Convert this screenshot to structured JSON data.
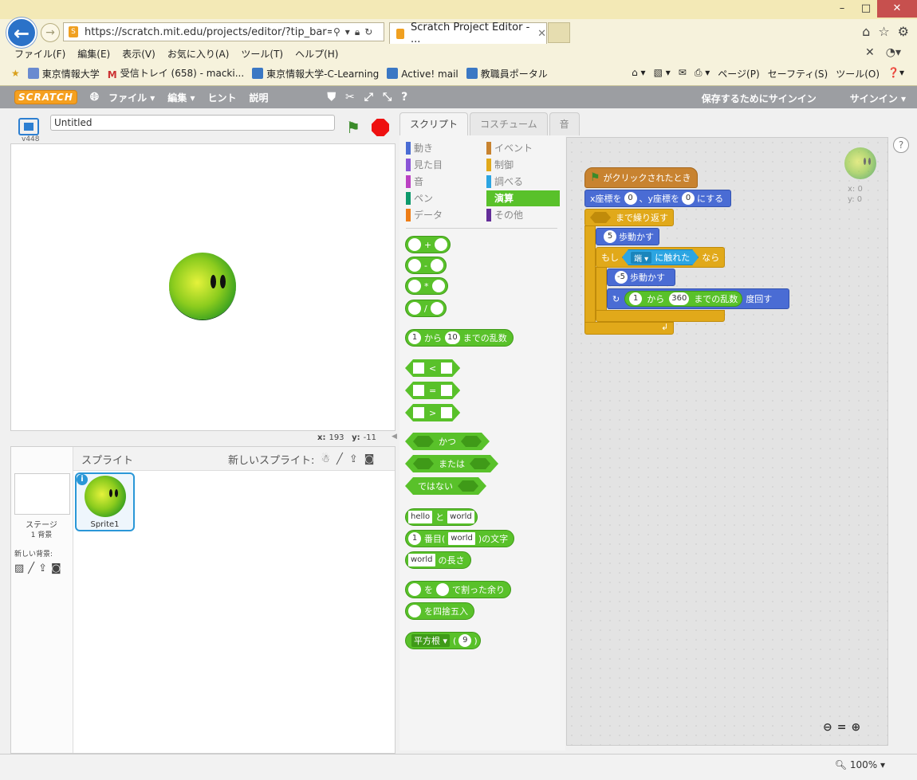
{
  "browser": {
    "url": "https://scratch.mit.edu/projects/editor/?tip_bar=get",
    "tab_title": "Scratch Project Editor - ...",
    "menus": [
      "ファイル(F)",
      "編集(E)",
      "表示(V)",
      "お気に入り(A)",
      "ツール(T)",
      "ヘルプ(H)"
    ],
    "favorites": [
      "東京情報大学",
      "受信トレイ (658) - macki...",
      "東京情報大学-C-Learning",
      "Active! mail",
      "教職員ポータル"
    ],
    "fav_right": [
      "ページ(P)",
      "セーフティ(S)",
      "ツール(O)"
    ],
    "zoom": "100%"
  },
  "scratch": {
    "logo": "SCRATCH",
    "menu": [
      "ファイル ▾",
      "編集 ▾",
      "ヒント",
      "説明"
    ],
    "signin_save": "保存するためにサインイン",
    "signin": "サインイン ▾"
  },
  "stage": {
    "version": "v448",
    "project_title": "Untitled",
    "x_label": "x:",
    "x_value": "193",
    "y_label": "y:",
    "y_value": "-11"
  },
  "sprites": {
    "title": "スプライト",
    "new_sprite": "新しいスプライト:",
    "stage_label": "ステージ",
    "stage_bg_count": "1 背景",
    "new_backdrop": "新しい背景:",
    "sprite1_name": "Sprite1"
  },
  "tabs": [
    "スクリプト",
    "コスチューム",
    "音"
  ],
  "categories": [
    {
      "label": "動き",
      "color": "#4a6cd4"
    },
    {
      "label": "イベント",
      "color": "#c88330"
    },
    {
      "label": "見た目",
      "color": "#8a55d7"
    },
    {
      "label": "制御",
      "color": "#e1a91a"
    },
    {
      "label": "音",
      "color": "#bb42c3"
    },
    {
      "label": "調べる",
      "color": "#2ca5e2"
    },
    {
      "label": "ペン",
      "color": "#0e9a6c"
    },
    {
      "label": "演算",
      "color": "#59c12a"
    },
    {
      "label": "データ",
      "color": "#ee7d16"
    },
    {
      "label": "その他",
      "color": "#632d99"
    }
  ],
  "palette": {
    "plus": "+",
    "minus": "-",
    "times": "*",
    "divide": "/",
    "random_from": "1",
    "random_mid": "から",
    "random_to": "10",
    "random_end": "までの乱数",
    "lt": "<",
    "eq": "=",
    "gt": ">",
    "and": "かつ",
    "or": "または",
    "not": "ではない",
    "join_a": "hello",
    "join_mid": "と",
    "join_b": "world",
    "letter_n": "1",
    "letter_mid": "番目(",
    "letter_s": "world",
    "letter_end": ")の文字",
    "length_s": "world",
    "length_end": "の長さ",
    "mod_a": "を",
    "mod_end": "で割った余り",
    "round": "を四捨五入",
    "sqrt_fn": "平方根 ▾",
    "sqrt_open": "(",
    "sqrt_val": "9",
    "sqrt_close": ")"
  },
  "script": {
    "when_flag": "がクリックされたとき",
    "goto_x_label": "x座標を",
    "goto_x": "0",
    "goto_y_label": "、y座標を",
    "goto_y": "0",
    "goto_end": "にする",
    "repeat_until": "まで繰り返す",
    "move_n": "5",
    "move_label": "歩動かす",
    "if_label": "もし",
    "touching_dd": "端 ▾",
    "touching_label": "に触れた",
    "then_label": "なら",
    "move_back_n": "-5",
    "move_back_label": "歩動かす",
    "turn_from": "1",
    "turn_mid": "から",
    "turn_to": "360",
    "turn_rand_end": "までの乱数",
    "turn_end": "度回す",
    "sprite_x": "x: 0",
    "sprite_y": "y: 0"
  }
}
